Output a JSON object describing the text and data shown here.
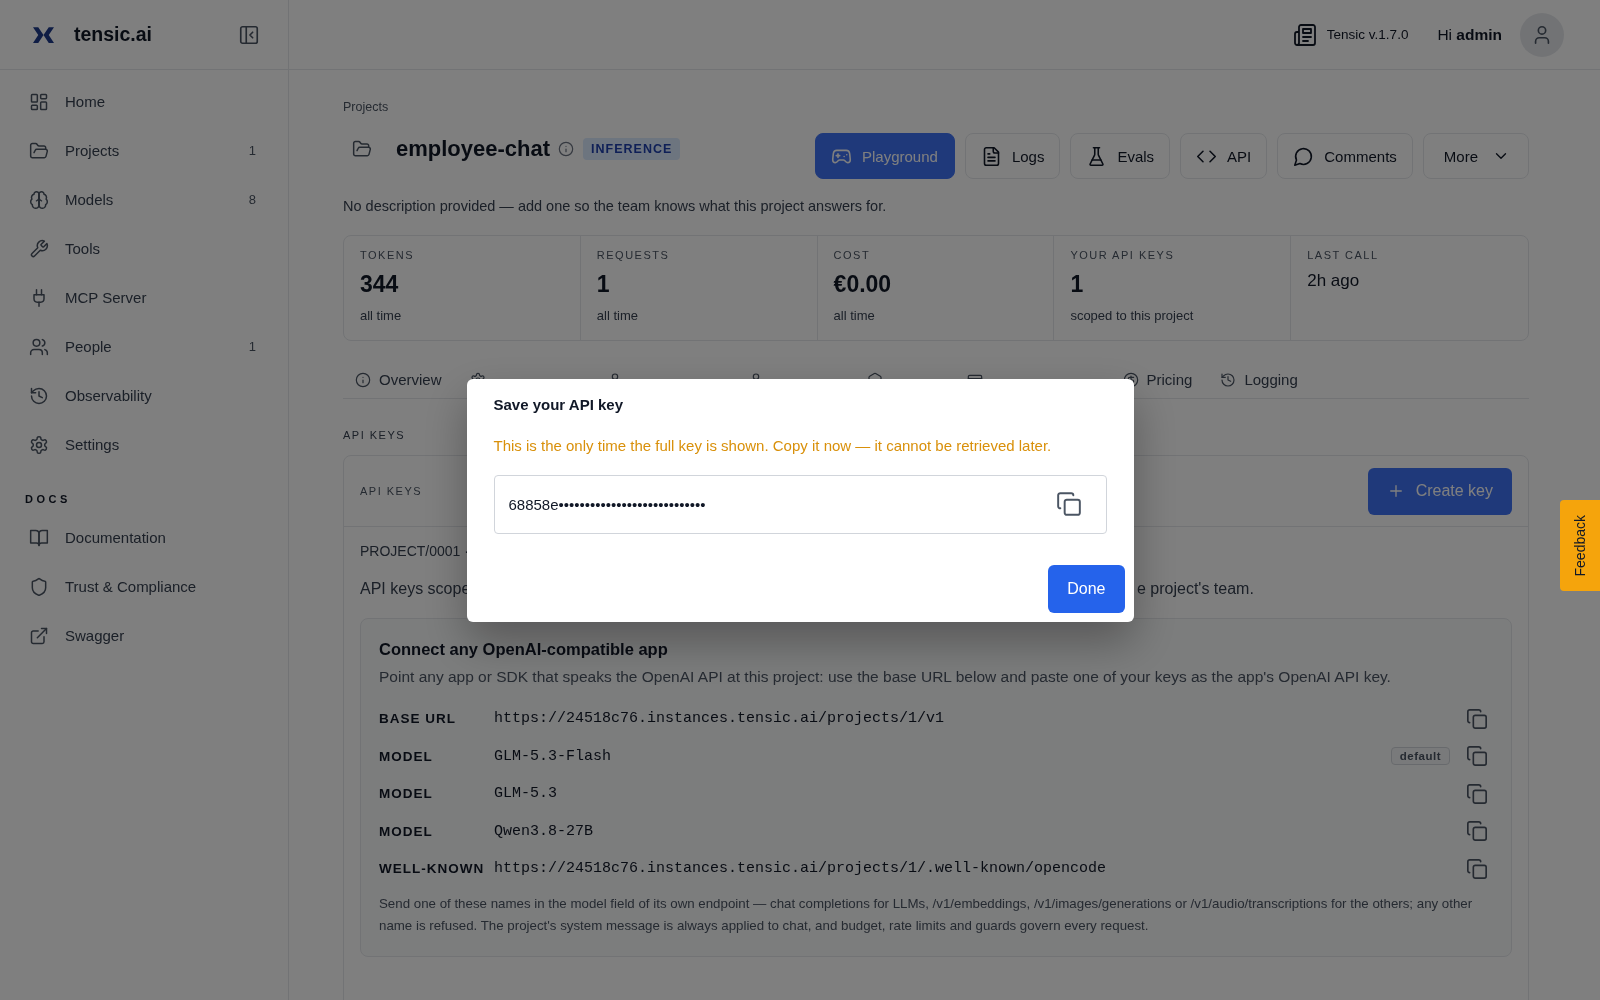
{
  "sidebar": {
    "brand": "tensic.ai",
    "items": [
      {
        "label": "Home"
      },
      {
        "label": "Projects",
        "count": "1"
      },
      {
        "label": "Models",
        "count": "8"
      },
      {
        "label": "Tools"
      },
      {
        "label": "MCP Server"
      },
      {
        "label": "People",
        "count": "1"
      },
      {
        "label": "Observability"
      },
      {
        "label": "Settings"
      }
    ],
    "docs_heading": "DOCS",
    "docs_items": [
      {
        "label": "Documentation"
      },
      {
        "label": "Trust & Compliance"
      },
      {
        "label": "Swagger"
      }
    ]
  },
  "header": {
    "version": "Tensic v.1.7.0",
    "greeting": "Hi **admin**"
  },
  "project": {
    "breadcrumb": "Projects",
    "name": "employee-chat",
    "badge": "INFERENCE",
    "actions": [
      {
        "kind": "primary",
        "label": "Playground"
      },
      {
        "kind": "plain",
        "label": "Logs"
      },
      {
        "kind": "plain",
        "label": "Evals"
      },
      {
        "kind": "plain",
        "label": "API"
      },
      {
        "kind": "plain",
        "label": "Comments"
      },
      {
        "kind": "menu",
        "label": "More"
      }
    ],
    "description": "No description provided — add one so the team knows what this project answers for."
  },
  "stats": [
    {
      "kind": "number",
      "label": "TOKENS",
      "value": "344",
      "note": "all time"
    },
    {
      "kind": "number",
      "label": "REQUESTS",
      "value": "1",
      "note": "all time"
    },
    {
      "kind": "number",
      "label": "COST",
      "value": "€0.00",
      "note": "all time"
    },
    {
      "kind": "number",
      "label": "YOUR API KEYS",
      "value": "1",
      "note": "scoped to this project"
    },
    {
      "kind": "text",
      "label": "LAST CALL",
      "value": "2h ago"
    }
  ],
  "tabs": [
    {
      "kind": "tab",
      "label": "Overview"
    },
    {
      "kind": "covered"
    },
    {
      "kind": "covered"
    },
    {
      "kind": "covered"
    },
    {
      "kind": "covered"
    },
    {
      "kind": "covered"
    },
    {
      "kind": "tab",
      "label": "Pricing"
    },
    {
      "kind": "tab",
      "label": "Logging"
    }
  ],
  "api_keys": {
    "section_label": "API KEYS",
    "card_label": "API KEYS",
    "create_button": "Create key",
    "project_ref": "PROJECT/0001 ·",
    "intro_visible_start": "API keys scope",
    "intro_visible_end": "e project's team."
  },
  "connect": {
    "title": "Connect any OpenAI-compatible app",
    "description": "Point any app or SDK that speaks the OpenAI API at this project: use the base URL below and paste one of your keys as the app's OpenAI API key.",
    "rows": [
      {
        "label": "BASE URL",
        "value": "https://24518c76.instances.tensic.ai/projects/1/v1"
      },
      {
        "label": "MODEL",
        "value": "GLM-5.3-Flash",
        "badge": "default"
      },
      {
        "label": "MODEL",
        "value": "GLM-5.3"
      },
      {
        "label": "MODEL",
        "value": "Qwen3.8-27B"
      },
      {
        "label": "WELL-KNOWN",
        "value": "https://24518c76.instances.tensic.ai/projects/1/.well-known/opencode"
      }
    ],
    "footnote": "Send one of these names in the model field of its own endpoint — chat completions for LLMs, /v1/embeddings, /v1/images/generations or /v1/audio/transcriptions for the others; any other name is refused. The project's system message is always applied to chat, and budget, rate limits and guards govern every request."
  },
  "modal": {
    "title": "Save your API key",
    "warning": "This is the only time the full key is shown. Copy it now — it cannot be retrieved later.",
    "key_value": "68858e••••••••••••••••••••••••••••",
    "button": "Done"
  },
  "feedback": "Feedback"
}
